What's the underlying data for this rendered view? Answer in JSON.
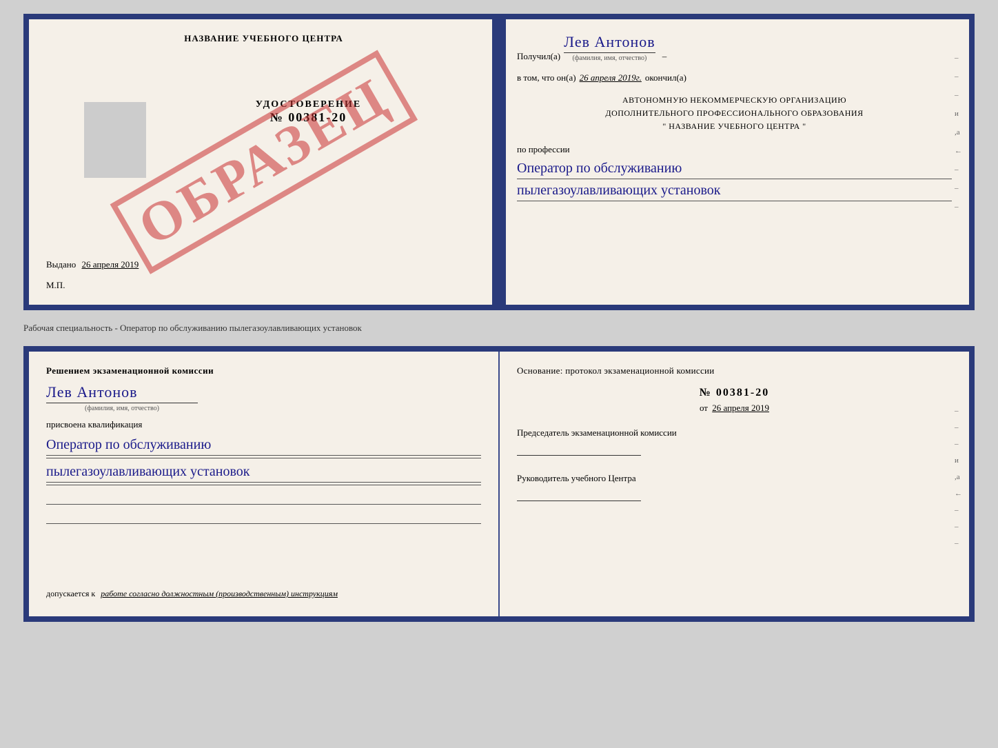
{
  "top_book": {
    "left": {
      "training_center_title": "НАЗВАНИЕ УЧЕБНОГО ЦЕНТРА",
      "certificate_label": "УДОСТОВЕРЕНИЕ",
      "certificate_number": "№ 00381-20",
      "issued_label": "Выдано",
      "issued_date": "26 апреля 2019",
      "mp_label": "М.П.",
      "obrazec": "ОБРАЗЕЦ"
    },
    "right": {
      "received_label": "Получил(а)",
      "recipient_name": "Лев Антонов",
      "fio_label": "(фамилия, имя, отчество)",
      "date_prefix": "в том, что он(а)",
      "completion_date": "26 апреля 2019г.",
      "completed_label": "окончил(а)",
      "org_line1": "АВТОНОМНУЮ НЕКОММЕРЧЕСКУЮ ОРГАНИЗАЦИЮ",
      "org_line2": "ДОПОЛНИТЕЛЬНОГО ПРОФЕССИОНАЛЬНОГО ОБРАЗОВАНИЯ",
      "org_line3": "\"  НАЗВАНИЕ УЧЕБНОГО ЦЕНТРА  \"",
      "profession_label": "по профессии",
      "profession_line1": "Оператор по обслуживанию",
      "profession_line2": "пылегазоулавливающих установок",
      "side_marks": [
        "–",
        "–",
        "–",
        "и",
        ",а",
        "←",
        "–",
        "–",
        "–"
      ]
    }
  },
  "middle_text": "Рабочая специальность - Оператор по обслуживанию пылегазоулавливающих установок",
  "bottom_book": {
    "left": {
      "decision_text": "Решением экзаменационной комиссии",
      "person_name": "Лев Антонов",
      "fio_label": "(фамилия, имя, отчество)",
      "assigned_label": "присвоена квалификация",
      "qualification_line1": "Оператор по обслуживанию",
      "qualification_line2": "пылегазоулавливающих установок",
      "allowed_prefix": "допускается к",
      "allowed_text": "работе согласно должностным (производственным) инструкциям"
    },
    "right": {
      "basis_label": "Основание: протокол экзаменационной комиссии",
      "protocol_number": "№ 00381-20",
      "date_prefix": "от",
      "protocol_date": "26 апреля 2019",
      "chairman_label": "Председатель экзаменационной комиссии",
      "director_label": "Руководитель учебного Центра",
      "side_marks": [
        "–",
        "–",
        "–",
        "и",
        ",а",
        "←",
        "–",
        "–",
        "–"
      ]
    }
  }
}
